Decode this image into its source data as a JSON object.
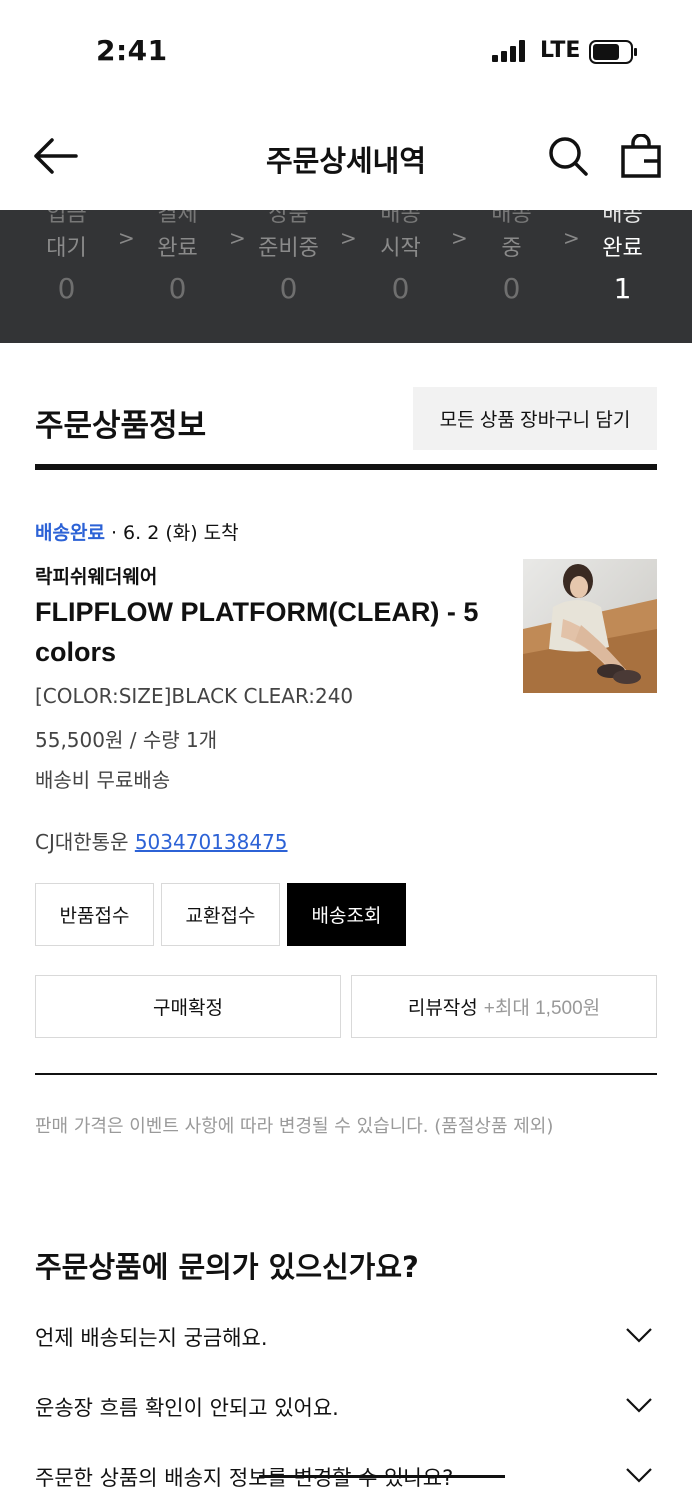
{
  "status_bar": {
    "time": "2:41",
    "network": "LTE"
  },
  "header": {
    "title": "주문상세내역",
    "back_icon": "arrow-left-icon",
    "search_icon": "search-icon",
    "bag_icon": "shopping-bag-icon"
  },
  "order_steps": [
    {
      "label_line1": "입금",
      "label_line2": "대기",
      "count": "0",
      "active": false
    },
    {
      "label_line1": "결제",
      "label_line2": "완료",
      "count": "0",
      "active": false
    },
    {
      "label_line1": "상품",
      "label_line2": "준비중",
      "count": "0",
      "active": false
    },
    {
      "label_line1": "배송",
      "label_line2": "시작",
      "count": "0",
      "active": false
    },
    {
      "label_line1": "배송",
      "label_line2": "중",
      "count": "0",
      "active": false
    },
    {
      "label_line1": "배송",
      "label_line2": "완료",
      "count": "1",
      "active": true
    }
  ],
  "section": {
    "title": "주문상품정보",
    "add_all_to_cart": "모든 상품 장바구니 담기"
  },
  "product": {
    "status": "배송완료",
    "arrival": " · 6. 2 (화) 도착",
    "brand": "락피쉬웨더웨어",
    "name": "FLIPFLOW PLATFORM(CLEAR) - 5 colors",
    "option": "[COLOR:SIZE]BLACK CLEAR:240",
    "price_qty": "55,500원 / 수량 1개",
    "shipping_fee": "배송비 무료배송",
    "courier": "CJ대한통운",
    "tracking_number": "503470138475"
  },
  "actions": {
    "return": "반품접수",
    "exchange": "교환접수",
    "track": "배송조회",
    "confirm": "구매확정",
    "review": "리뷰작성",
    "review_bonus": "+최대 1,500원"
  },
  "notice": "판매 가격은 이벤트 사항에 따라 변경될 수 있습니다. (품절상품 제외)",
  "faq": {
    "title": "주문상품에 문의가 있으신가요?",
    "items": [
      "언제 배송되는지 궁금해요.",
      "운송장 흐름 확인이 안되고 있어요.",
      "주문한 상품의 배송지 정보를 변경할 수 있나요?"
    ]
  },
  "colors": {
    "accent_blue": "#2c62d6",
    "step_bar_bg": "#333436"
  }
}
